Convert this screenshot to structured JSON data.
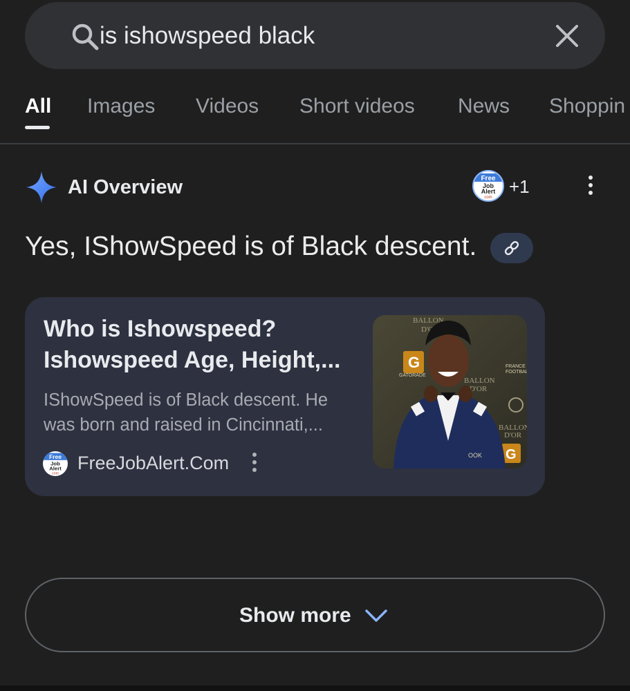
{
  "search": {
    "query": "is ishowspeed black",
    "icon": "search-icon",
    "clear_icon": "close-icon"
  },
  "tabs": [
    {
      "label": "All",
      "active": true
    },
    {
      "label": "Images",
      "active": false
    },
    {
      "label": "Videos",
      "active": false
    },
    {
      "label": "Short videos",
      "active": false
    },
    {
      "label": "News",
      "active": false
    },
    {
      "label": "Shoppin",
      "active": false
    }
  ],
  "ai_overview": {
    "title": "AI Overview",
    "source_logo_text": [
      "Free",
      "Job",
      "Alert",
      "com"
    ],
    "extra_sources": "+1",
    "answer": "Yes, IShowSpeed is of Black descent.",
    "link_icon": "link-icon"
  },
  "result_card": {
    "title": "Who is Ishowspeed? Ishowspeed Age, Height,...",
    "snippet": "IShowSpeed is of Black descent. He was born and raised in Cincinnati,...",
    "source_name": "FreeJobAlert.Com",
    "thumbnail_text": [
      "BALLON",
      "D'OR",
      "GATORADE",
      "BALLON",
      "D'OR",
      "FRANCE",
      "FOOTBALL"
    ]
  },
  "show_more": {
    "label": "Show more",
    "icon": "chevron-down-icon"
  },
  "colors": {
    "background": "#1f1f1f",
    "card": "#2d3140",
    "accent": "#8ab4f8",
    "sparkle": "#4c8df6"
  }
}
